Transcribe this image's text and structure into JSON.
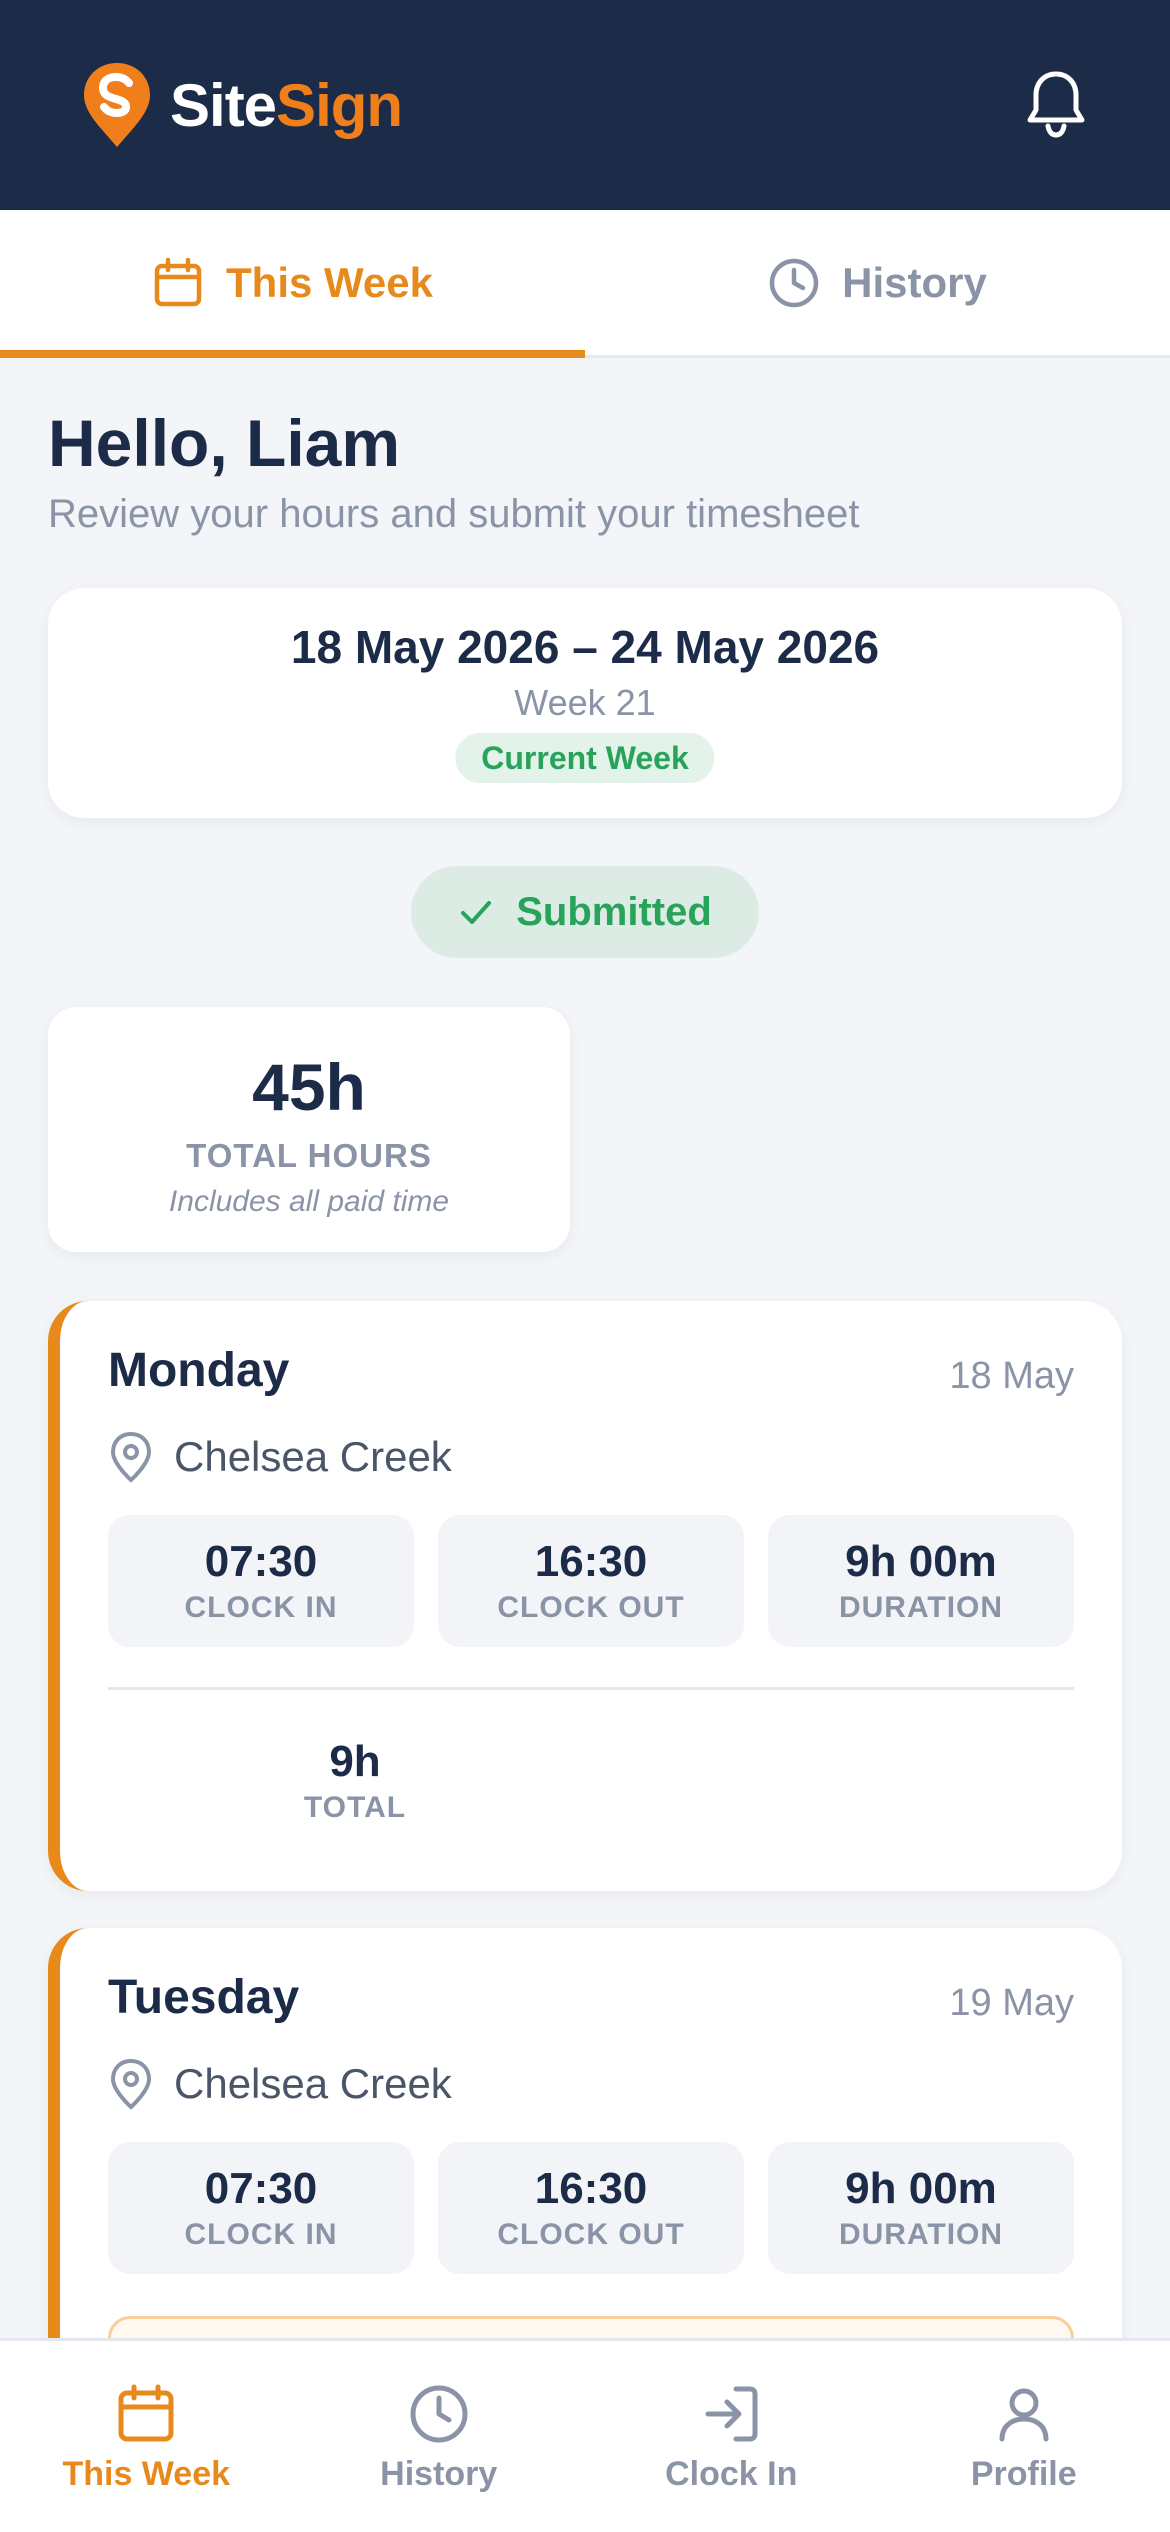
{
  "header": {
    "logo_site": "Site",
    "logo_sign": "Sign",
    "bell_icon": "bell-icon"
  },
  "top_tabs": [
    {
      "label": "This Week",
      "icon": "calendar-icon",
      "active": true
    },
    {
      "label": "History",
      "icon": "clock-icon",
      "active": false
    }
  ],
  "greeting": {
    "title": "Hello, Liam",
    "subtitle": "Review your hours and submit your timesheet"
  },
  "week": {
    "range": "18 May 2026 – 24 May 2026",
    "number": "Week 21",
    "badge": "Current Week"
  },
  "status": {
    "label": "Submitted",
    "icon": "check-icon"
  },
  "summary": {
    "total_hours": "45h",
    "label": "TOTAL HOURS",
    "note": "Includes all paid time"
  },
  "days": [
    {
      "name": "Monday",
      "date": "18 May",
      "site": "Chelsea Creek",
      "clock_in": "07:30",
      "clock_in_label": "CLOCK IN",
      "clock_out": "16:30",
      "clock_out_label": "CLOCK OUT",
      "duration": "9h 00m",
      "duration_label": "DURATION",
      "total": "9h",
      "total_label": "TOTAL"
    },
    {
      "name": "Tuesday",
      "date": "19 May",
      "site": "Chelsea Creek",
      "clock_in": "07:30",
      "clock_in_label": "CLOCK IN",
      "clock_out": "16:30",
      "clock_out_label": "CLOCK OUT",
      "duration": "9h 00m",
      "duration_label": "DURATION"
    }
  ],
  "bottom_nav": [
    {
      "label": "This Week",
      "icon": "calendar-icon",
      "active": true
    },
    {
      "label": "History",
      "icon": "clock-icon",
      "active": false
    },
    {
      "label": "Clock In",
      "icon": "sign-in-icon",
      "active": false
    },
    {
      "label": "Profile",
      "icon": "user-icon",
      "active": false
    }
  ],
  "colors": {
    "header_bg": "#1c2b48",
    "accent": "#e8891c",
    "success": "#27a35a",
    "background": "#f3f5f8"
  }
}
